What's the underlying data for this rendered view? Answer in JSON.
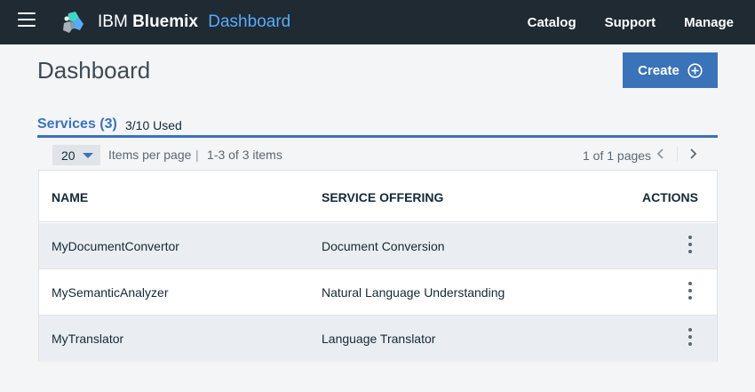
{
  "topbar": {
    "brand_ibm": "IBM",
    "brand_product": "Bluemix",
    "brand_section": "Dashboard",
    "nav": [
      "Catalog",
      "Support",
      "Manage"
    ]
  },
  "page": {
    "title": "Dashboard",
    "create_label": "Create"
  },
  "services": {
    "title": "Services (3)",
    "used": "3/10 Used"
  },
  "pagination": {
    "per_page": "20",
    "per_page_label": "Items per page",
    "separator": "|",
    "range": "1-3 of 3 items",
    "pages": "1 of 1 pages"
  },
  "table": {
    "columns": [
      "NAME",
      "SERVICE OFFERING",
      "ACTIONS"
    ],
    "rows": [
      {
        "name": "MyDocumentConvertor",
        "offering": "Document Conversion"
      },
      {
        "name": "MySemanticAnalyzer",
        "offering": "Natural Language Understanding"
      },
      {
        "name": "MyTranslator",
        "offering": "Language Translator"
      }
    ]
  },
  "colors": {
    "topbar": "#1f2a33",
    "accent": "#3b73b9",
    "link_blue": "#5aaafa",
    "background": "#f4f5f7",
    "row_shade": "#eaeef3"
  },
  "icons": {
    "menu": "hamburger-icon",
    "logo": "bluemix-logo-icon",
    "create": "plus-circle-icon",
    "per_page": "chevron-down-icon",
    "prev": "chevron-left-icon",
    "next": "chevron-right-icon",
    "row_actions": "overflow-menu-icon"
  }
}
